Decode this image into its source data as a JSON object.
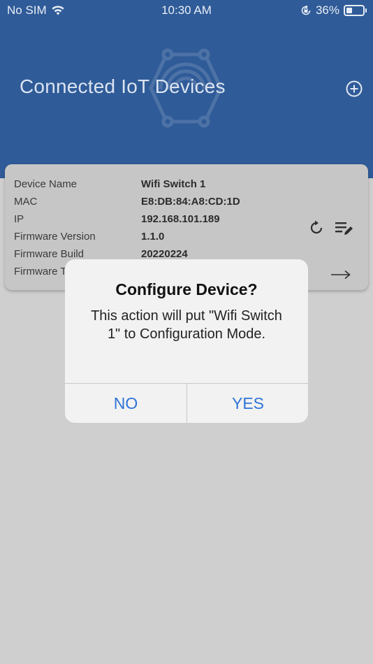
{
  "status_bar": {
    "carrier": "No SIM",
    "time": "10:30 AM",
    "battery_percent": "36%",
    "battery_level": 0.36,
    "icons": [
      "wifi-icon",
      "orientation-lock-icon",
      "battery-icon"
    ]
  },
  "header": {
    "title": "Connected IoT Devices",
    "add_icon": "plus-circle-icon",
    "background_color": "#2f5b98"
  },
  "device_card": {
    "fields": [
      {
        "label": "Device Name",
        "value": "Wifi Switch 1"
      },
      {
        "label": "MAC",
        "value": "E8:DB:84:A8:CD:1D"
      },
      {
        "label": "IP",
        "value": "192.168.101.189"
      },
      {
        "label": "Firmware Version",
        "value": "1.1.0"
      },
      {
        "label": "Firmware Build",
        "value": "20220224"
      },
      {
        "label": "Firmware T",
        "value": ""
      }
    ],
    "icons": [
      "refresh-icon",
      "edit-list-icon",
      "arrow-right-icon"
    ]
  },
  "dialog": {
    "title": "Configure Device?",
    "message": "This action will put \"Wifi Switch 1\" to Configuration Mode.",
    "no_label": "NO",
    "yes_label": "YES",
    "accent_color": "#2f74d8"
  }
}
